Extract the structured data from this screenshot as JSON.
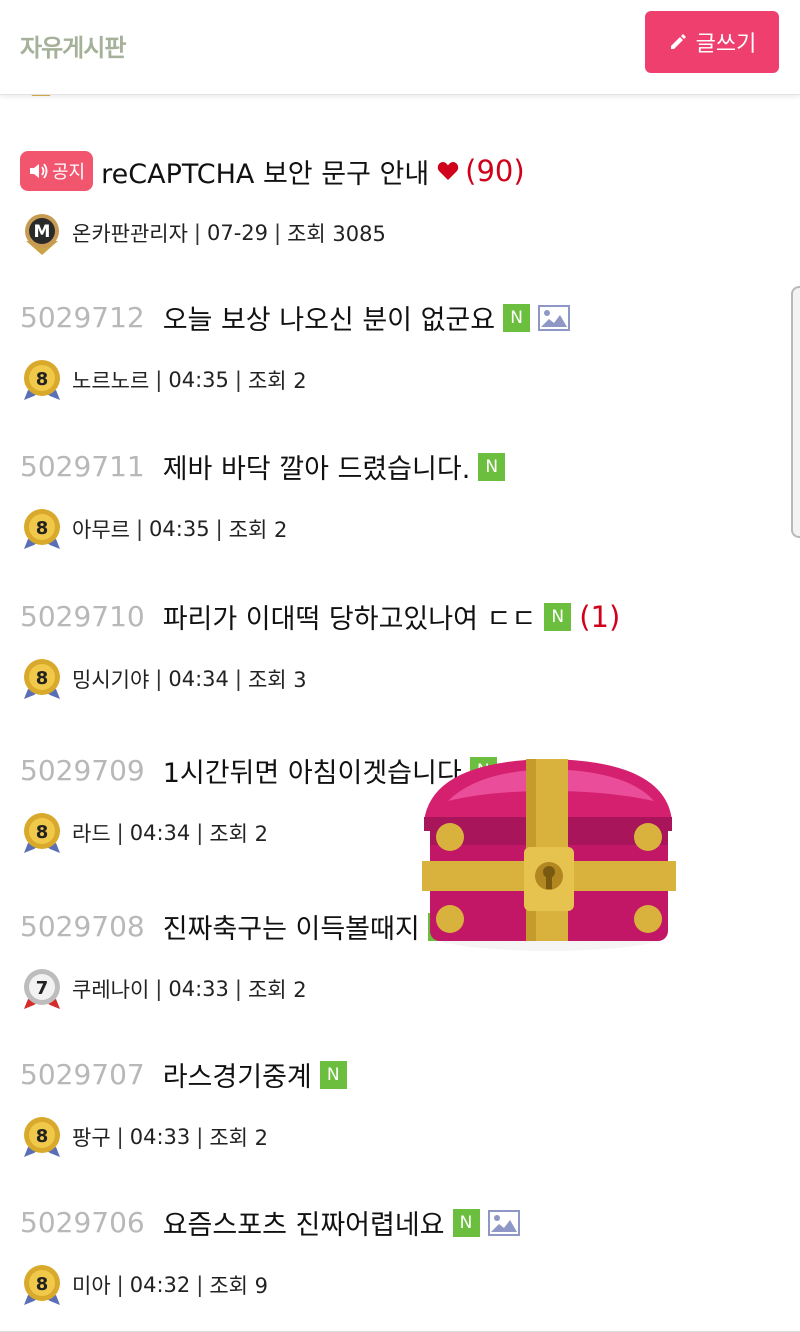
{
  "header": {
    "board_title": "자유게시판",
    "write_button": "글쓰기"
  },
  "notice": {
    "tag": "공지",
    "title": "reCAPTCHA 보안 문구 안내",
    "comment_count": "(90)",
    "author": "온카판관리자",
    "date": "07-29",
    "views": "조회 3085"
  },
  "posts": [
    {
      "no": "5029712",
      "title": "오늘 보상 나오신 분이 없군요",
      "new": "N",
      "author": "노르노르",
      "time": "04:35",
      "views": "조회 2",
      "level": "8"
    },
    {
      "no": "5029711",
      "title": "제바 바닥 깔아 드렸습니다.",
      "new": "N",
      "author": "아무르",
      "time": "04:35",
      "views": "조회 2",
      "level": "8"
    },
    {
      "no": "5029710",
      "title": "파리가 이대떡 당하고있나여 ㄷㄷ",
      "new": "N",
      "comments": "(1)",
      "author": "밍시기야",
      "time": "04:34",
      "views": "조회 3",
      "level": "8"
    },
    {
      "no": "5029709",
      "title": "1시간뒤면 아침이겟습니다",
      "new": "N",
      "author": "라드",
      "time": "04:34",
      "views": "조회 2",
      "level": "8"
    },
    {
      "no": "5029708",
      "title": "진짜축구는 이득볼때지",
      "new": "N",
      "author": "쿠레나이",
      "time": "04:33",
      "views": "조회 2",
      "level": "7"
    },
    {
      "no": "5029707",
      "title": "라스경기중계",
      "new": "N",
      "author": "팡구",
      "time": "04:33",
      "views": "조회 2",
      "level": "8"
    },
    {
      "no": "5029706",
      "title": "요즘스포츠 진짜어렵네요",
      "new": "N",
      "author": "미아",
      "time": "04:32",
      "views": "조회 9",
      "level": "8"
    }
  ],
  "colors": {
    "accent": "#ee3f6e",
    "new_badge": "#6cbf3e",
    "comment_count": "#d0021b",
    "board_title": "#a6b19a",
    "notice_tag": "#f2566f"
  }
}
